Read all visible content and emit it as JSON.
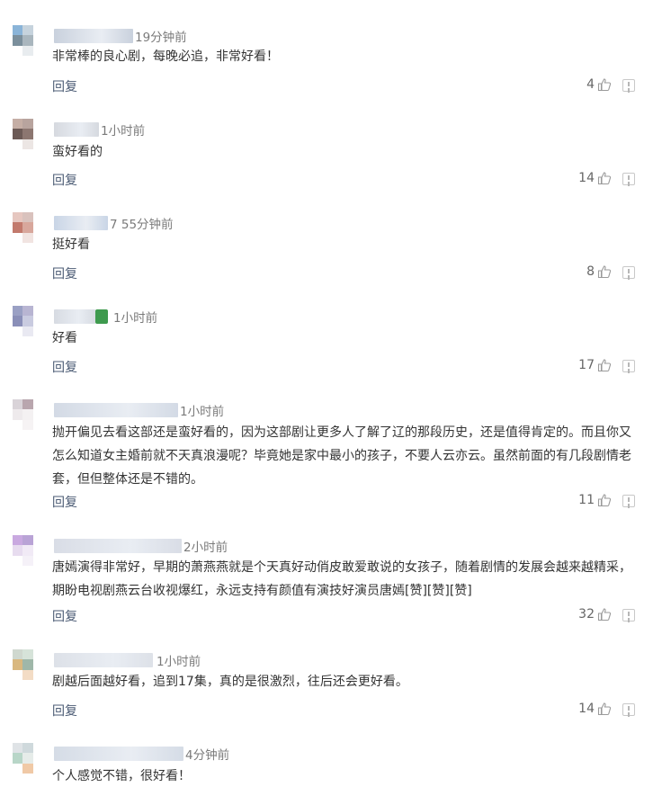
{
  "ui": {
    "reply_label": "回复",
    "like_icon": "thumbs-up-icon",
    "report_icon": "report-icon"
  },
  "comments": [
    {
      "time": "19分钟前",
      "text": "非常棒的良心剧，每晚必追，非常好看！",
      "likes": "4",
      "avatar_colors": [
        "#8ab4d8",
        "#c6d3dd",
        "#ffffff",
        "#7b8f9c",
        "#a9b6be",
        "#ffffff",
        "#ffffff",
        "#e8ecef",
        "#ffffff"
      ],
      "name_color": "#c9d1dd"
    },
    {
      "time": "1小时前",
      "text": "蛮好看的",
      "likes": "14",
      "avatar_colors": [
        "#c5aea5",
        "#b8a49e",
        "#ffffff",
        "#6c5a56",
        "#8c7670",
        "#ffffff",
        "#ffffff",
        "#ece6e4",
        "#ffffff"
      ],
      "name_color": "#d6d9df"
    },
    {
      "time": "7 55分钟前",
      "text": "挺好看",
      "likes": "8",
      "avatar_colors": [
        "#e6c7c0",
        "#d9c2bd",
        "#ffffff",
        "#c27a6d",
        "#d8a79c",
        "#ffffff",
        "#ffffff",
        "#f1e4e1",
        "#ffffff"
      ],
      "name_color": "#c9d5e6"
    },
    {
      "time": "1小时前",
      "text": "好看",
      "likes": "17",
      "avatar_colors": [
        "#9aa0c4",
        "#b8b5d2",
        "#ffffff",
        "#8a8fb8",
        "#c9cbe0",
        "#ffffff",
        "#ffffff",
        "#e9e9f2",
        "#ffffff"
      ],
      "name_color": "#d7dbe2"
    },
    {
      "time": "1小时前",
      "text": "抛开偏见去看这部还是蛮好看的，因为这部剧让更多人了解了辽的那段历史，还是值得肯定的。而且你又怎么知道女主婚前就不天真浪漫呢？毕竟她是家中最小的孩子，不要人云亦云。虽然前面的有几段剧情老套，但但整体还是不错的。",
      "likes": "11",
      "avatar_colors": [
        "#d9d3d8",
        "#b9a6ae",
        "#ffffff",
        "#eeeaec",
        "#f4f1f2",
        "#ffffff",
        "#ffffff",
        "#f6f3f4",
        "#ffffff"
      ],
      "name_color": "#d3dae5"
    },
    {
      "time": "2小时前",
      "text": "唐嫣演得非常好，早期的萧燕燕就是个天真好动俏皮敢爱敢说的女孩子，随着剧情的发展会越来越精采，期盼电视剧燕云台收视爆红，永远支持有颜值有演技好演员唐嫣[赞][赞][赞]",
      "likes": "32",
      "avatar_colors": [
        "#c9a9e0",
        "#b9a3d6",
        "#ffffff",
        "#e7dcef",
        "#f1eaf6",
        "#ffffff",
        "#ffffff",
        "#f5f1f8",
        "#ffffff"
      ],
      "name_color": "#d9dde6"
    },
    {
      "time": "1小时前",
      "text": "剧越后面越好看，追到17集，真的是很激烈，往后还会更好看。",
      "likes": "14",
      "avatar_colors": [
        "#cfd8cf",
        "#d6e3d9",
        "#ffffff",
        "#d9b87f",
        "#9fb7a9",
        "#ffffff",
        "#ffffff",
        "#f3dcc5",
        "#ffffff"
      ],
      "name_color": "#dde1e8"
    },
    {
      "time": "4分钟前",
      "text": "个人感觉不错，很好看！",
      "likes": "",
      "avatar_colors": [
        "#dfe3e6",
        "#cfd9dc",
        "#ffffff",
        "#b8d6c8",
        "#e6ece9",
        "#ffffff",
        "#ffffff",
        "#f0c9a6",
        "#ffffff"
      ],
      "name_color": "#d5dce6"
    }
  ]
}
